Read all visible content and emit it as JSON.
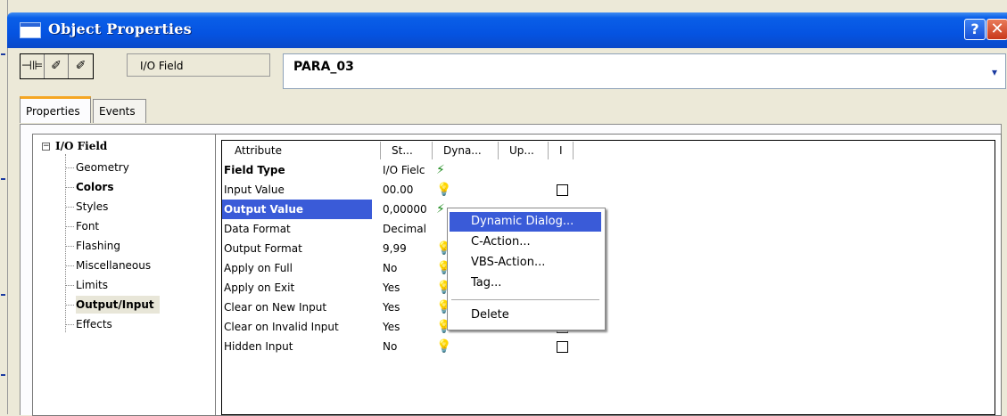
{
  "window": {
    "title": "Object Properties",
    "help_glyph": "?",
    "close_glyph": "✕"
  },
  "toolbar": {
    "buttons": [
      "⊣⊫",
      "✐",
      "✐"
    ],
    "object_type": "I/O Field",
    "object_name": "PARA_03",
    "dropdown_glyph": "▾"
  },
  "tabs": [
    "Properties",
    "Events"
  ],
  "tree": {
    "root_toggle": "−",
    "root": "I/O Field",
    "items": [
      "Geometry",
      "Colors",
      "Styles",
      "Font",
      "Flashing",
      "Miscellaneous",
      "Limits",
      "Output/Input",
      "Effects"
    ],
    "selected": "Output/Input"
  },
  "grid": {
    "headers": [
      "Attribute",
      "St...",
      "Dyna...",
      "Up...",
      "I"
    ],
    "rows": [
      {
        "attribute": "Field Type",
        "static": "I/O Fielc",
        "dyn": "bolt",
        "checkbox": false
      },
      {
        "attribute": "Input Value",
        "static": "00.00",
        "dyn": "bulb",
        "checkbox": true
      },
      {
        "attribute": "Output Value",
        "static": "0,00000",
        "dyn": "bolt",
        "checkbox": false
      },
      {
        "attribute": "Data Format",
        "static": "Decimal",
        "dyn": "",
        "checkbox": false
      },
      {
        "attribute": "Output Format",
        "static": "9,99",
        "dyn": "bulb",
        "checkbox": false
      },
      {
        "attribute": "Apply on Full",
        "static": "No",
        "dyn": "bulb",
        "checkbox": false
      },
      {
        "attribute": "Apply on Exit",
        "static": "Yes",
        "dyn": "bulb",
        "checkbox": false
      },
      {
        "attribute": "Clear on New Input",
        "static": "Yes",
        "dyn": "bulb",
        "checkbox": false
      },
      {
        "attribute": "Clear on Invalid Input",
        "static": "Yes",
        "dyn": "bulb",
        "checkbox": false
      },
      {
        "attribute": "Hidden Input",
        "static": "No",
        "dyn": "bulb",
        "checkbox": true
      }
    ],
    "dyn_glyphs": {
      "bolt": "⚡",
      "bulb": "💡"
    }
  },
  "context_menu": {
    "items": [
      "Dynamic Dialog...",
      "C-Action...",
      "VBS-Action...",
      "Tag...",
      "Delete"
    ],
    "highlighted": "Dynamic Dialog..."
  }
}
